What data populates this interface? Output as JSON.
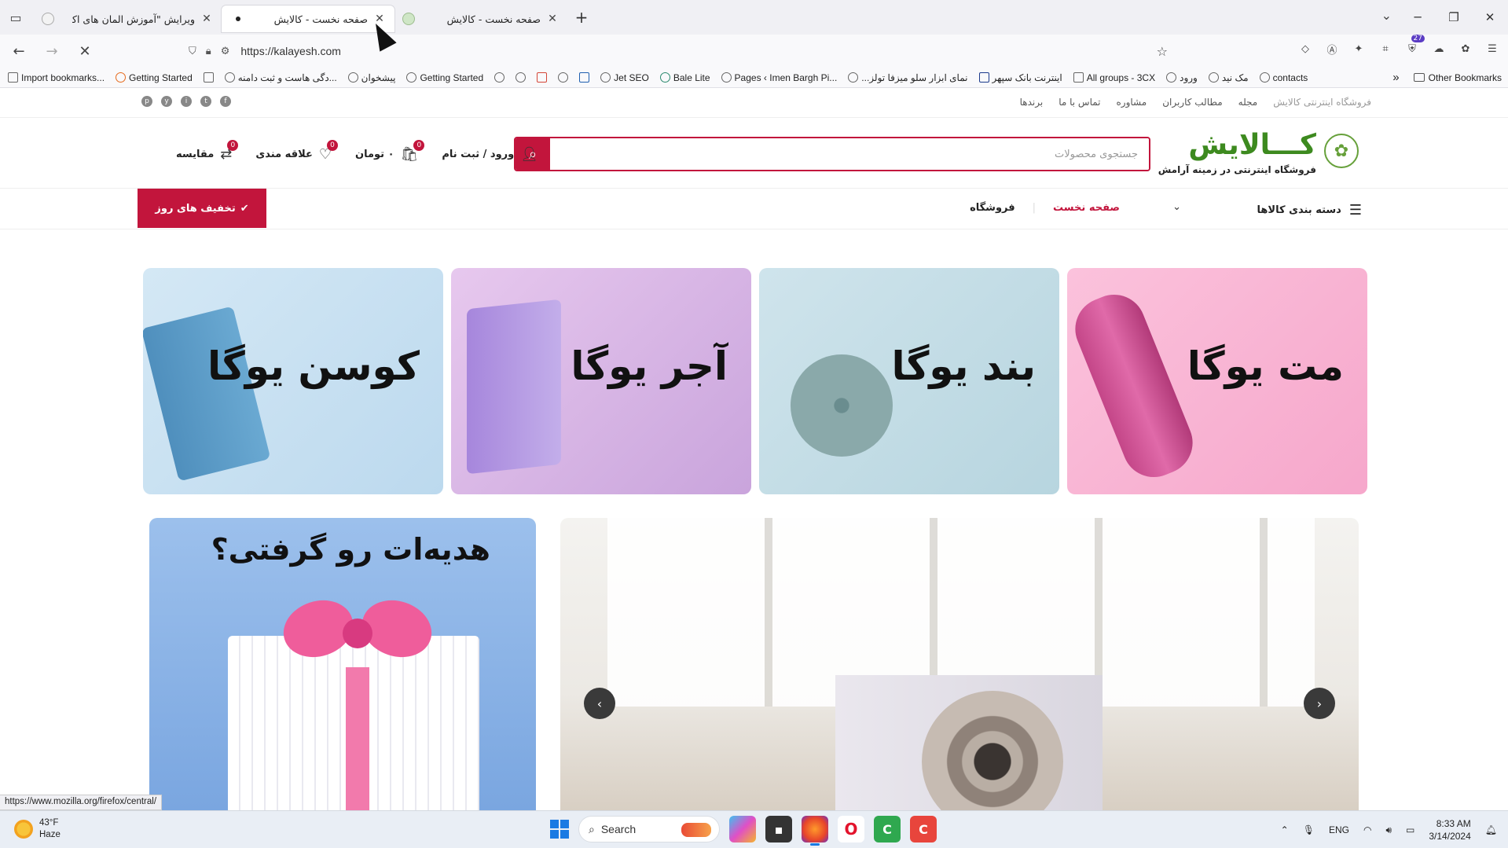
{
  "browser": {
    "tabs": [
      {
        "title": "",
        "favicon": "loading-icon"
      },
      {
        "title": "ویرایش \"آموزش المان های اکسترا – عا",
        "close": "✕"
      },
      {
        "title": "صفحه نخست - کالایش",
        "close": "✕",
        "active": true
      },
      {
        "title": "صفحه نخست - کالایش",
        "close": "✕"
      }
    ],
    "new_tab": "+",
    "window_controls": {
      "minimize": "─",
      "maximize": "❐",
      "close": "✕"
    },
    "tab_overflow": "⌄",
    "url": "https://kalayesh.com",
    "extension_badge": "27",
    "bookmarks": [
      {
        "label": "Import bookmarks..."
      },
      {
        "label": "Getting Started"
      },
      {
        "label": ""
      },
      {
        "label": "...دگی هاست و ثبت دامنه"
      },
      {
        "label": "پیشخوان"
      },
      {
        "label": "Getting Started"
      },
      {
        "label": ""
      },
      {
        "label": ""
      },
      {
        "label": ""
      },
      {
        "label": ""
      },
      {
        "label": ""
      },
      {
        "label": "Jet SEO"
      },
      {
        "label": "Bale Lite"
      },
      {
        "label": "Pages ‹ Imen Bargh Pi..."
      },
      {
        "label": "...نمای ابزار سلو میزفا تولز"
      },
      {
        "label": "اینترنت بانک سپهر"
      },
      {
        "label": "All groups - 3CX"
      },
      {
        "label": "ورود"
      },
      {
        "label": "مک نید"
      },
      {
        "label": "contacts"
      }
    ],
    "bookmarks_overflow": "»",
    "other_bookmarks": "Other Bookmarks",
    "status_url": "https://www.mozilla.org/firefox/central/"
  },
  "site": {
    "top_links": [
      "فروشگاه اینترنتی کالایش",
      "مجله",
      "مطالب کاربران",
      "مشاوره",
      "تماس با ما",
      "برندها"
    ],
    "socials": [
      "f",
      "t",
      "i",
      "y",
      "p"
    ],
    "logo": {
      "name": "کـــالایش",
      "tagline": "فروشگاه اینترنتی در زمینه آرامش"
    },
    "search_placeholder": "جستجوی محصولات",
    "header_actions": {
      "login": "ورود / ثبت نام",
      "cart_label": "۰ تومان",
      "cart_count": "0",
      "wishlist": "علاقه مندی",
      "wishlist_count": "0",
      "compare": "مقایسه",
      "compare_count": "0"
    },
    "category_menu": "دسته بندی کالاها",
    "nav": {
      "home": "صفحه نخست",
      "shop": "فروشگاه"
    },
    "deals_button": "تخفیف های روز",
    "cards": [
      {
        "label": "مت یوگا"
      },
      {
        "label": "بند یوگا"
      },
      {
        "label": "آجر یوگا"
      },
      {
        "label": "کوسن یوگا"
      }
    ],
    "gift_banner_title": "هدیه‌ات رو گرفتی؟",
    "slider_prev": "‹",
    "slider_next": "›"
  },
  "taskbar": {
    "weather_temp": "43°F",
    "weather_desc": "Haze",
    "search_label": "Search",
    "language": "ENG",
    "time": "8:33 AM",
    "date": "3/14/2024"
  }
}
